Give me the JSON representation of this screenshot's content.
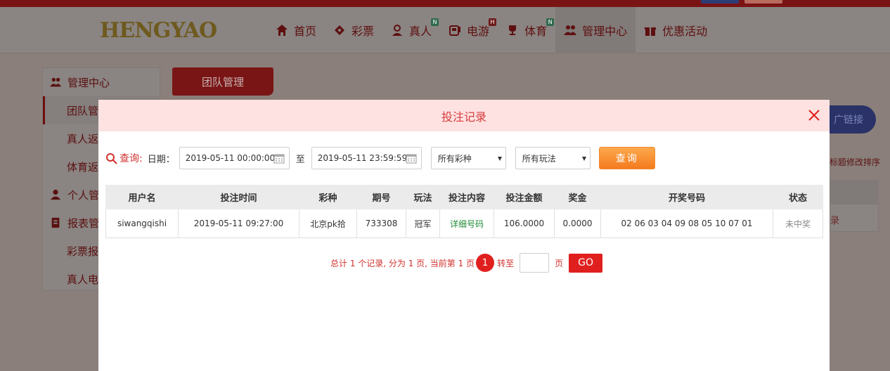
{
  "nav": {
    "logo_text": "HENGYAO",
    "items": [
      {
        "label": "首页",
        "icon": "home-icon"
      },
      {
        "label": "彩票",
        "icon": "ticket-icon"
      },
      {
        "label": "真人",
        "icon": "dealer-icon",
        "badge": "N"
      },
      {
        "label": "电游",
        "icon": "slot-icon",
        "badge": "H"
      },
      {
        "label": "体育",
        "icon": "trophy-icon",
        "badge": "N"
      },
      {
        "label": "管理中心",
        "icon": "users-icon"
      },
      {
        "label": "优惠活动",
        "icon": "gift-icon"
      }
    ]
  },
  "sidebar": {
    "items": [
      {
        "label": "管理中心",
        "icon": "users-icon"
      },
      {
        "label": "团队管"
      },
      {
        "label": "真人返"
      },
      {
        "label": "体育返"
      },
      {
        "label": "个人管",
        "icon": "person-icon"
      },
      {
        "label": "报表管",
        "icon": "report-icon"
      },
      {
        "label": "彩票报"
      },
      {
        "label": "真人电"
      }
    ]
  },
  "page": {
    "tab_label": "团队管理",
    "promo_label": "广链接",
    "sort_hint": "标题修改排序",
    "right_link": "录"
  },
  "modal": {
    "title": "投注记录",
    "query_label": "查询:",
    "date_label": "日期：",
    "start_date": "2019-05-11 00:00:00",
    "to_label": "至",
    "end_date": "2019-05-11 23:59:59",
    "lottery_select": "所有彩种",
    "play_select": "所有玩法",
    "query_button": "查询"
  },
  "table": {
    "headers": [
      "用户名",
      "投注时间",
      "彩种",
      "期号",
      "玩法",
      "投注内容",
      "投注金额",
      "奖金",
      "开奖号码",
      "状态"
    ],
    "rows": [
      [
        "siwangqishi",
        "2019-05-11 09:27:00",
        "北京pk拾",
        "733308",
        "冠军",
        "详细号码",
        "106.0000",
        "0.0000",
        "02 06 03 04 09 08 05 10 07 01",
        "未中奖"
      ]
    ]
  },
  "pager": {
    "summary": "总计 1 个记录, 分为 1 页, 当前第 1 页",
    "current_page": "1",
    "goto_label": "转至",
    "page_unit": "页",
    "go_button": "GO"
  },
  "colors": {
    "accent_red": "#e0201e",
    "modal_header_bg": "#fde2e1",
    "query_button": "#f47a1e",
    "detail_green": "#1f8b34"
  }
}
